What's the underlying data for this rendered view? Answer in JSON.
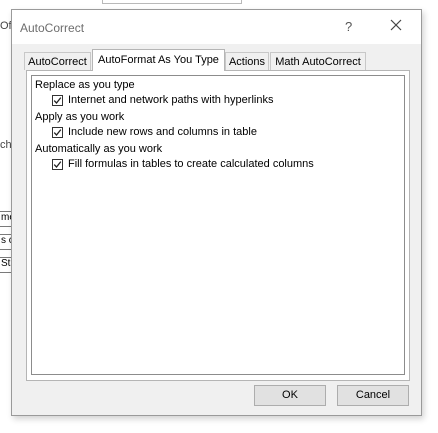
{
  "background": {
    "fragments": [
      "Of",
      "ch",
      "me",
      "s c",
      "Sta"
    ]
  },
  "dialog": {
    "title": "AutoCorrect",
    "help_label": "?",
    "tabs": [
      {
        "label": "AutoCorrect"
      },
      {
        "label": "AutoFormat As You Type",
        "active": true
      },
      {
        "label": "Actions"
      },
      {
        "label": "Math AutoCorrect"
      }
    ],
    "groups": [
      {
        "label": "Replace as you type",
        "options": [
          {
            "label": "Internet and network paths with hyperlinks",
            "checked": true
          }
        ]
      },
      {
        "label": "Apply as you work",
        "options": [
          {
            "label": "Include new rows and columns in table",
            "checked": true
          }
        ]
      },
      {
        "label": "Automatically as you work",
        "options": [
          {
            "label": "Fill formulas in tables to create calculated columns",
            "checked": true
          }
        ]
      }
    ],
    "buttons": {
      "ok": "OK",
      "cancel": "Cancel"
    }
  }
}
